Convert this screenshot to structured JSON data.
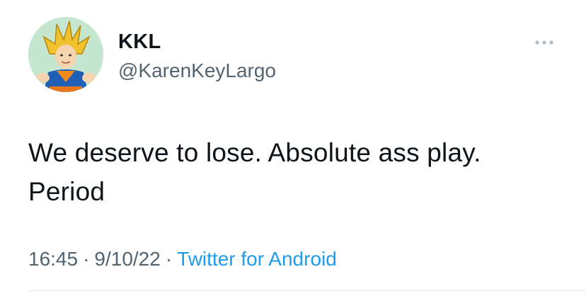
{
  "user": {
    "display_name": "KKL",
    "handle": "@KarenKeyLargo",
    "avatar_icon": "avatar-image"
  },
  "tweet": {
    "text": "We deserve to lose. Absolute ass play. Period"
  },
  "meta": {
    "time": "16:45",
    "separator": "·",
    "date": "9/10/22",
    "source": "Twitter for Android"
  },
  "icons": {
    "more": "more-options-icon"
  },
  "colors": {
    "text": "#0f1419",
    "secondary": "#536471",
    "link": "#1d9bf0",
    "divider": "#e6e9eb"
  }
}
